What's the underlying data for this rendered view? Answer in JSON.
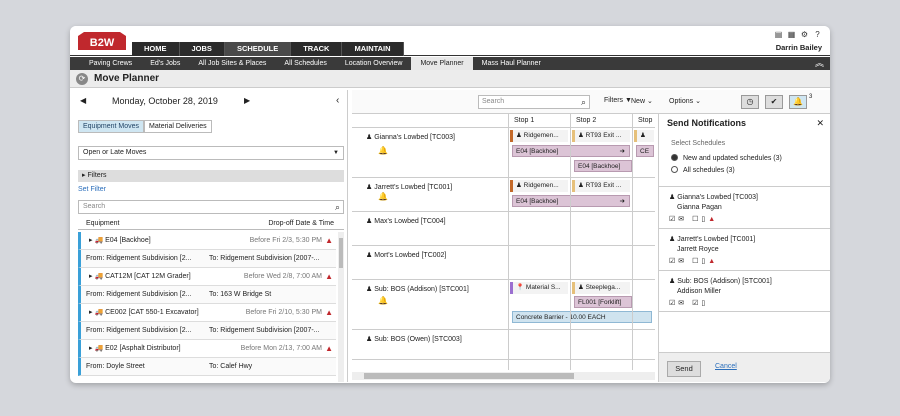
{
  "brand": "B2W",
  "user": "Darrin Bailey",
  "mainnav": [
    "HOME",
    "JOBS",
    "SCHEDULE",
    "TRACK",
    "MAINTAIN"
  ],
  "subnav": [
    "Paving Crews",
    "Ed's Jobs",
    "All Job Sites & Places",
    "All Schedules",
    "Location Overview",
    "Move Planner",
    "Mass Haul Planner"
  ],
  "page_title": "Move Planner",
  "date": "Monday, October 28, 2019",
  "tabs": [
    "Equipment Moves",
    "Material Deliveries"
  ],
  "select_value": "Open or Late Moves",
  "filters_label": "Filters",
  "set_filter": "Set Filter",
  "search_placeholder": "Search",
  "col_equipment": "Equipment",
  "col_dropoff": "Drop-off Date & Time",
  "items": [
    {
      "name": "E04 [Backhoe]",
      "date": "Before Fri 2/3, 5:30 PM",
      "from": "From: Ridgement Subdivision [2...",
      "to": "To: Ridgement Subdivision [2007-..."
    },
    {
      "name": "CAT12M [CAT 12M Grader]",
      "date": "Before Wed 2/8, 7:00 AM",
      "from": "From: Ridgement Subdivision [2...",
      "to": "To: 163 W Bridge St"
    },
    {
      "name": "CE002 [CAT 550-1 Excavator]",
      "date": "Before Fri 2/10, 5:30 PM",
      "from": "From: Ridgement Subdivision [2...",
      "to": "To: Ridgement Subdivision [2007-..."
    },
    {
      "name": "E02 [Asphalt Distributor]",
      "date": "Before Mon 2/13, 7:00 AM",
      "from": "From: Doyle Street",
      "to": "To: Calef Hwy"
    }
  ],
  "mid_search": "Search",
  "mid_filters": "Filters",
  "new_label": "New",
  "options_label": "Options",
  "bell_count": "3",
  "stops": [
    "Stop 1",
    "Stop 2",
    "Stop"
  ],
  "rows": [
    {
      "name": "Gianna's Lowbed [TC003]",
      "s1": "Ridgemen...",
      "s2": "RT93 Exit ...",
      "s3": "CE",
      "bar1": "E04 [Backhoe]",
      "bar2": "E04 [Backhoe]"
    },
    {
      "name": "Jarrett's Lowbed [TC001]",
      "s1": "Ridgemen...",
      "s2": "RT93 Exit ...",
      "bar1": "E04 [Backhoe]"
    },
    {
      "name": "Max's Lowbed [TC004]"
    },
    {
      "name": "Mort's Lowbed [TC002]"
    },
    {
      "name": "Sub: BOS (Addison) [STC001]",
      "s1": "Material S...",
      "s2": "Steeplega...",
      "bar1": "FL001 [Forklift]",
      "bar2": "Concrete Barrier - 10.00 EACH"
    },
    {
      "name": "Sub: BOS (Owen) [STC003]"
    }
  ],
  "notif": {
    "title": "Send Notifications",
    "select_schedules": "Select Schedules",
    "opt1": "New and updated schedules (3)",
    "opt2": "All schedules (3)",
    "sections": [
      {
        "label": "Gianna's Lowbed [TC003]",
        "person": "Gianna Pagan"
      },
      {
        "label": "Jarrett's Lowbed [TC001]",
        "person": "Jarrett Royce"
      },
      {
        "label": "Sub: BOS (Addison) [STC001]",
        "person": "Addison Miller"
      }
    ],
    "send": "Send",
    "cancel": "Cancel"
  },
  "colors": {
    "accent": "#3aa0d8",
    "warning": "#c0282d",
    "bar": "#dcc4d6"
  }
}
